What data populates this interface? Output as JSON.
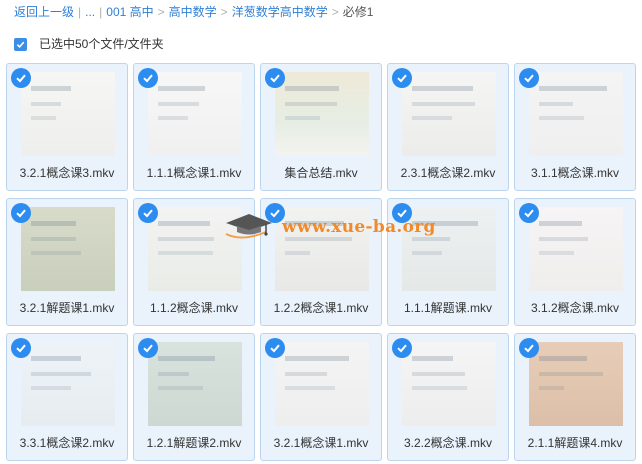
{
  "breadcrumb": {
    "back": "返回上一级",
    "ellipsis": "...",
    "items": [
      "001 高中",
      "高中数学",
      "洋葱数学高中数学"
    ],
    "current": "必修1"
  },
  "selection": {
    "label": "已选中50个文件/文件夹",
    "checked": true
  },
  "watermark": {
    "text": "www.xue-ba.org",
    "logo": "graduation-cap-icon"
  },
  "colors": {
    "accent": "#2d8cf0",
    "tile_bg": "#eaf3fc",
    "tile_border": "#bcd5ef",
    "link": "#2f7fd6"
  },
  "files": [
    {
      "name": "3.2.1概念课3.mkv",
      "selected": true
    },
    {
      "name": "1.1.1概念课1.mkv",
      "selected": true
    },
    {
      "name": "集合总结.mkv",
      "selected": true
    },
    {
      "name": "2.3.1概念课2.mkv",
      "selected": true
    },
    {
      "name": "3.1.1概念课.mkv",
      "selected": true
    },
    {
      "name": "3.2.1解题课1.mkv",
      "selected": true
    },
    {
      "name": "1.1.2概念课.mkv",
      "selected": true
    },
    {
      "name": "1.2.2概念课1.mkv",
      "selected": true
    },
    {
      "name": "1.1.1解题课.mkv",
      "selected": true
    },
    {
      "name": "3.1.2概念课.mkv",
      "selected": true
    },
    {
      "name": "3.3.1概念课2.mkv",
      "selected": true
    },
    {
      "name": "1.2.1解题课2.mkv",
      "selected": true
    },
    {
      "name": "3.2.1概念课1.mkv",
      "selected": true
    },
    {
      "name": "3.2.2概念课.mkv",
      "selected": true
    },
    {
      "name": "2.1.1解题课4.mkv",
      "selected": true
    }
  ]
}
